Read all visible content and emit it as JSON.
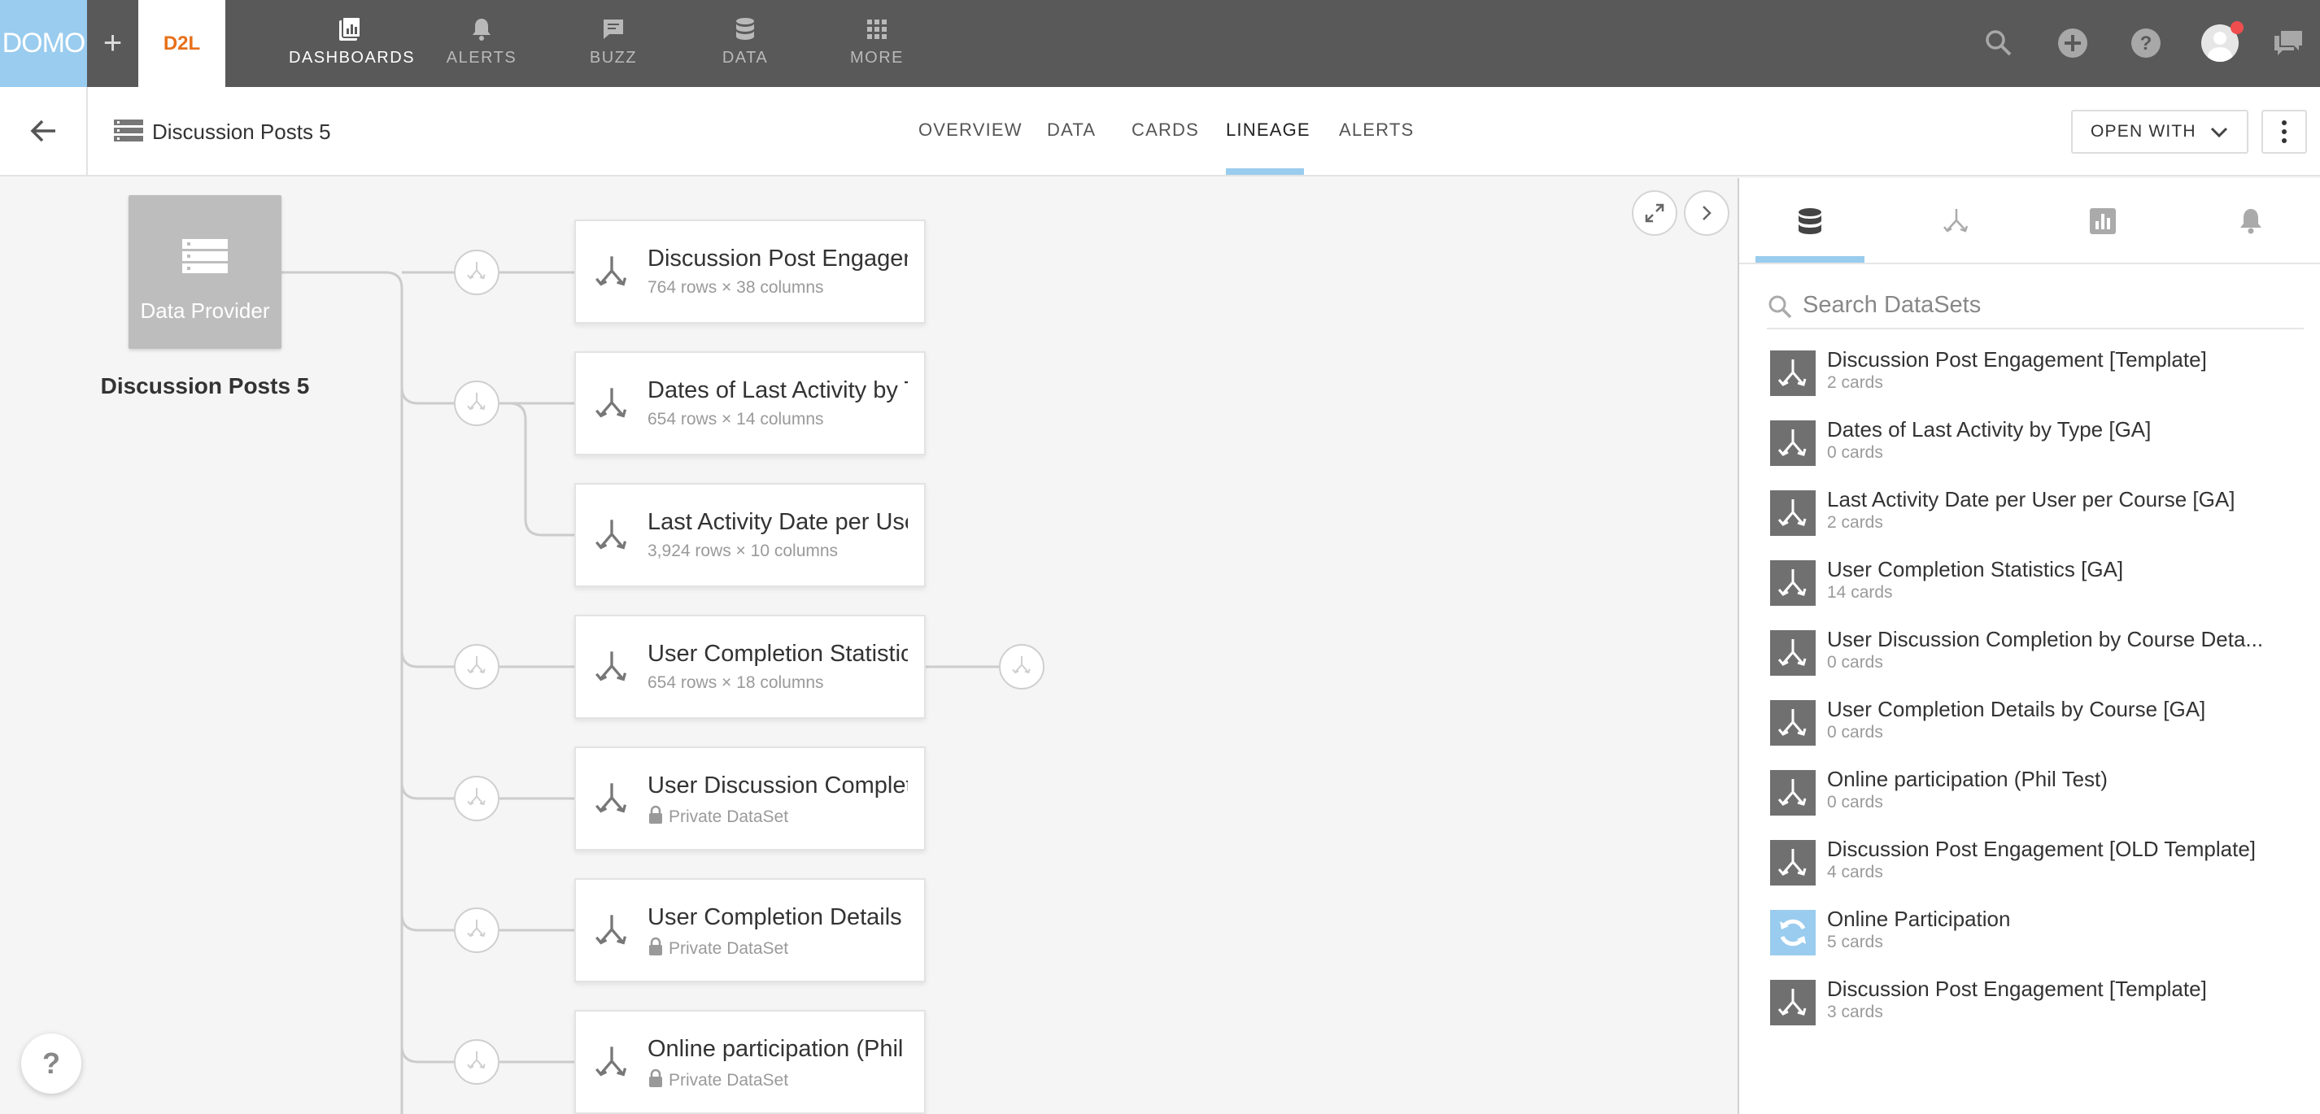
{
  "topnav": {
    "brand": "DOMO",
    "plus": "+",
    "partner_logo": "D2L",
    "items": [
      {
        "label": "DASHBOARDS",
        "icon": "dashboards-icon"
      },
      {
        "label": "ALERTS",
        "icon": "bell-icon"
      },
      {
        "label": "BUZZ",
        "icon": "chat-icon"
      },
      {
        "label": "DATA",
        "icon": "database-icon"
      },
      {
        "label": "MORE",
        "icon": "grid-icon"
      }
    ],
    "right_icons": [
      "search-icon",
      "add-icon",
      "help-icon",
      "avatar",
      "messages-icon"
    ],
    "colors": {
      "bar": "#595959",
      "brand_bg": "#99ccee",
      "partner_text": "#e8701a",
      "notification": "#f04e4e"
    }
  },
  "header": {
    "title": "Discussion Posts 5",
    "tabs": [
      "OVERVIEW",
      "DATA",
      "CARDS",
      "LINEAGE",
      "ALERTS"
    ],
    "active_tab": "LINEAGE",
    "open_with_label": "OPEN WITH"
  },
  "lineage": {
    "provider_label": "Data Provider",
    "provider_name": "Discussion Posts 5",
    "nodes": [
      {
        "title": "Discussion Post Engagement [Template]",
        "subtitle": "764 rows × 38 columns",
        "private": false
      },
      {
        "title": "Dates of Last Activity by Type [GA]",
        "subtitle": "654 rows × 14 columns",
        "private": false
      },
      {
        "title": "Last Activity Date per User per Course [GA]",
        "subtitle": "3,924 rows × 10 columns",
        "private": false
      },
      {
        "title": "User Completion Statistics [GA]",
        "subtitle": "654 rows × 18 columns",
        "private": false
      },
      {
        "title": "User Discussion Completion by Course Details",
        "subtitle": "Private DataSet",
        "private": true
      },
      {
        "title": "User Completion Details by Course [GA]",
        "subtitle": "Private DataSet",
        "private": true
      },
      {
        "title": "Online participation (Phil Test)",
        "subtitle": "Private DataSet",
        "private": true
      }
    ],
    "help_label": "?"
  },
  "panel": {
    "tabs": [
      "database-icon",
      "dataflow-icon",
      "cards-icon",
      "alerts-icon"
    ],
    "search_placeholder": "Search DataSets",
    "datasets": [
      {
        "name": "Discussion Post Engagement [Template]",
        "count": "2 cards",
        "icon": "dataflow-icon"
      },
      {
        "name": "Dates of Last Activity by Type [GA]",
        "count": "0 cards",
        "icon": "dataflow-icon"
      },
      {
        "name": "Last Activity Date per User per Course [GA]",
        "count": "2 cards",
        "icon": "dataflow-icon"
      },
      {
        "name": "User Completion Statistics [GA]",
        "count": "14 cards",
        "icon": "dataflow-icon"
      },
      {
        "name": "User Discussion Completion by Course Deta...",
        "count": "0 cards",
        "icon": "dataflow-icon"
      },
      {
        "name": "User Completion Details by Course [GA]",
        "count": "0 cards",
        "icon": "dataflow-icon"
      },
      {
        "name": "Online participation (Phil Test)",
        "count": "0 cards",
        "icon": "dataflow-icon"
      },
      {
        "name": "Discussion Post Engagement [OLD Template]",
        "count": "4 cards",
        "icon": "dataflow-icon"
      },
      {
        "name": "Online Participation",
        "count": "5 cards",
        "icon": "sync-icon"
      },
      {
        "name": "Discussion Post Engagement [Template]",
        "count": "3 cards",
        "icon": "dataflow-icon"
      }
    ]
  }
}
